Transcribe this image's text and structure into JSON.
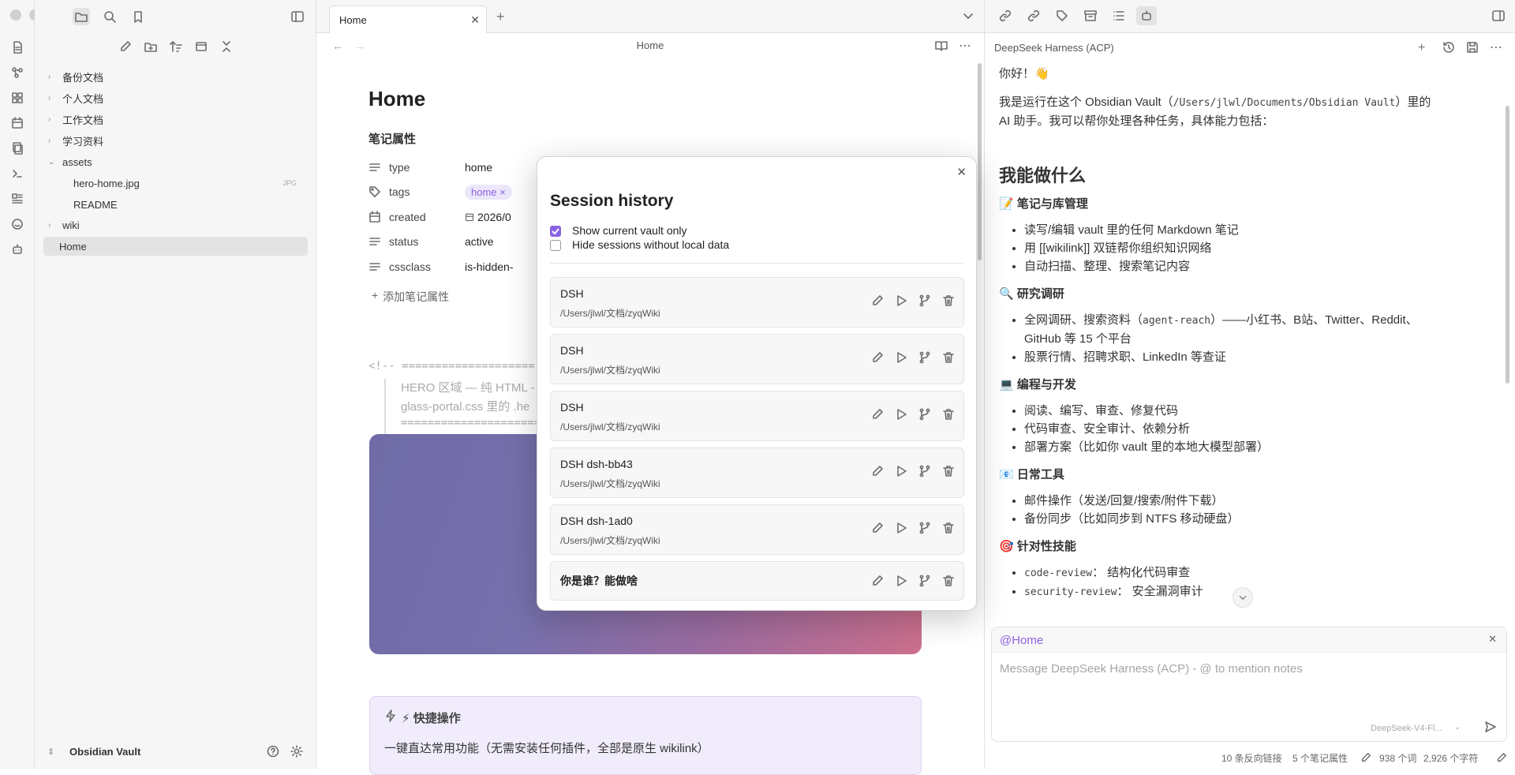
{
  "explorer": {
    "items": [
      {
        "label": "备份文档",
        "type": "folder",
        "expanded": false
      },
      {
        "label": "个人文档",
        "type": "folder",
        "expanded": false
      },
      {
        "label": "工作文档",
        "type": "folder",
        "expanded": false
      },
      {
        "label": "学习资料",
        "type": "folder",
        "expanded": false
      },
      {
        "label": "assets",
        "type": "folder",
        "expanded": true
      },
      {
        "label": "hero-home.jpg",
        "type": "file",
        "badge": "JPG"
      },
      {
        "label": "README",
        "type": "file"
      },
      {
        "label": "wiki",
        "type": "folder",
        "expanded": false
      },
      {
        "label": "Home",
        "type": "file",
        "active": true
      }
    ],
    "vault_name": "Obsidian Vault"
  },
  "editor": {
    "tab_title": "Home",
    "header_title": "Home",
    "note_title": "Home",
    "properties_heading": "笔记属性",
    "properties": [
      {
        "key": "type",
        "value": "home"
      },
      {
        "key": "tags",
        "value": "home ×"
      },
      {
        "key": "created",
        "value": "2026/0"
      },
      {
        "key": "status",
        "value": "active"
      },
      {
        "key": "cssclass",
        "value": "is-hidden-"
      }
    ],
    "add_property": "添加笔记属性",
    "comment_line1": "<!-- ====================",
    "comment_line2": "HERO 区域 — 纯 HTML -",
    "comment_line3": "glass-portal.css 里的 .he",
    "comment_line4": "========================",
    "quick_title": "⚡ 快捷操作",
    "quick_desc": "一键直达常用功能（无需安装任何插件，全部是原生 wikilink）"
  },
  "modal": {
    "title": "Session history",
    "opt1_label": "Show current vault only",
    "opt1_checked": true,
    "opt2_label": "Hide sessions without local data",
    "opt2_checked": false,
    "sessions": [
      {
        "title": "DSH",
        "path": "/Users/jlwl/文档/zyqWiki"
      },
      {
        "title": "DSH",
        "path": "/Users/jlwl/文档/zyqWiki"
      },
      {
        "title": "DSH",
        "path": "/Users/jlwl/文档/zyqWiki"
      },
      {
        "title": "DSH dsh-bb43",
        "path": "/Users/jlwl/文档/zyqWiki"
      },
      {
        "title": "DSH dsh-1ad0",
        "path": "/Users/jlwl/文档/zyqWiki"
      },
      {
        "title": "你是谁？能做啥",
        "path": ""
      }
    ]
  },
  "chat": {
    "panel_title": "DeepSeek Harness (ACP)",
    "greeting": "你好！👋",
    "intro_a": "我是运行在这个 Obsidian Vault（",
    "intro_code": "/Users/jlwl/Documents/Obsidian Vault",
    "intro_b": "）里的",
    "intro_c": "AI 助手。我可以帮你处理各种任务，具体能力包括：",
    "heading": "我能做什么",
    "s1_title": "📝 笔记与库管理",
    "s1_items": [
      "读写/编辑 vault 里的任何 Markdown 笔记",
      "用 [[wikilink]] 双链帮你组织知识网络",
      "自动扫描、整理、搜索笔记内容"
    ],
    "s2_title": "🔍 研究调研",
    "s2_item1_a": "全网调研、搜索资料（",
    "s2_item1_code": "agent-reach",
    "s2_item1_b": "）——小红书、B站、Twitter、Reddit、",
    "s2_item1_c": "GitHub 等 15 个平台",
    "s2_item2": "股票行情、招聘求职、LinkedIn 等查证",
    "s3_title": "💻 编程与开发",
    "s3_items": [
      "阅读、编写、审查、修复代码",
      "代码审查、安全审计、依赖分析",
      "部署方案（比如你 vault 里的本地大模型部署）"
    ],
    "s4_title": "📧 日常工具",
    "s4_items": [
      "邮件操作（发送/回复/搜索/附件下载）",
      "备份同步（比如同步到 NTFS 移动硬盘）"
    ],
    "s5_title": "🎯 针对性技能",
    "s5_item1_code": "code-review",
    "s5_item1_text": "： 结构化代码审查",
    "s5_item2_code": "security-review",
    "s5_item2_text": "： 安全漏洞审计",
    "context_chip": "@Home",
    "input_placeholder": "Message DeepSeek Harness (ACP) - @ to mention notes",
    "model": "DeepSeek-V4-Fl..."
  },
  "status": {
    "backlinks": "10 条反向链接",
    "props": "5 个笔记属性",
    "words": "938 个词",
    "chars": "2,926 个字符"
  },
  "colors": {
    "accent": "#8a63e0",
    "hero_gradient_from": "#6f6ba6",
    "hero_gradient_to": "#cc6f8c",
    "quick_bg": "#f1ecfb"
  }
}
